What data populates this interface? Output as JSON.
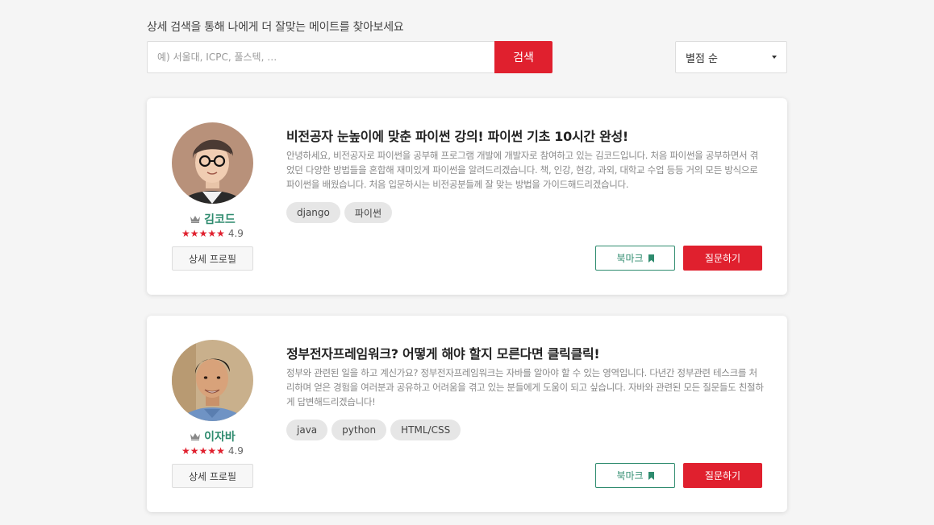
{
  "search": {
    "title": "상세 검색을 통해 나에게 더 잘맞는 메이트를 찾아보세요",
    "placeholder": "예) 서울대, ICPC, 풀스텍, …",
    "button_label": "검색"
  },
  "sort": {
    "selected": "별점 순"
  },
  "colors": {
    "accent_red": "#e0202e",
    "accent_green": "#2e8b6e"
  },
  "mentors": [
    {
      "name": "김코드",
      "stars": "★★★★★",
      "rating": "4.9",
      "profile_button": "상세 프로필",
      "title": "비전공자 눈높이에 맞춘 파이썬 강의! 파이썬 기초 10시간 완성!",
      "description": "안녕하세요, 비전공자로 파이썬을 공부해 프로그램 개발에 개발자로 참여하고 있는 김코드입니다. 처음 파이썬을 공부하면서 겪었던 다양한 방법들을 혼합해 재미있게 파이썬을 알려드리겠습니다. 책, 인강, 현강, 과외, 대학교 수업 등등 거의 모든 방식으로 파이썬을 배웠습니다. 처음 입문하시는 비전공분들께 잘 맞는 방법을 가이드해드리겠습니다.",
      "tags": [
        "django",
        "파이썬"
      ],
      "bookmark_label": "북마크",
      "ask_label": "질문하기"
    },
    {
      "name": "이자바",
      "stars": "★★★★★",
      "rating": "4.9",
      "profile_button": "상세 프로필",
      "title": "정부전자프레임워크? 어떻게 해야 할지 모른다면 클릭클릭!",
      "description": "정부와 관련된 일을 하고 계신가요? 정부전자프레임워크는 자바를 알아야 할 수 있는 영역입니다. 다년간 정부관련 테스크를 처리하며 얻은 경험을 여러분과 공유하고 어려움을 겪고 있는 분들에게 도움이 되고 싶습니다. 자바와 관련된 모든 질문들도 친절하게 답변해드리겠습니다!",
      "tags": [
        "java",
        "python",
        "HTML/CSS"
      ],
      "bookmark_label": "북마크",
      "ask_label": "질문하기"
    }
  ]
}
